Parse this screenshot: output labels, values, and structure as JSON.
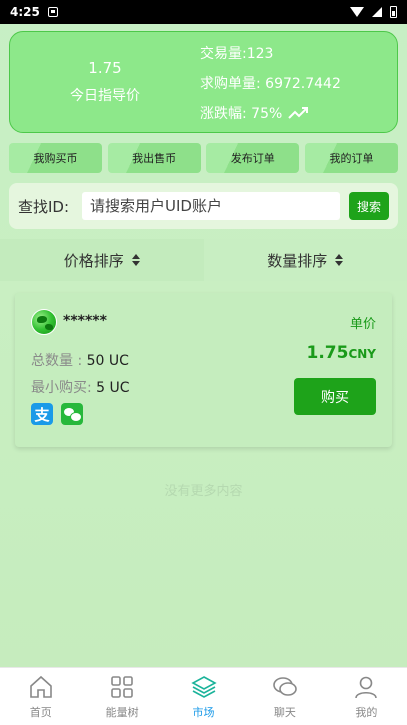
{
  "status_bar": {
    "time": "4:25"
  },
  "summary": {
    "price": "1.75",
    "price_label": "今日指导价",
    "volume": "交易量:123",
    "buy_order_qty": "求购单量: 6972.7442",
    "change": "涨跌幅: 75%"
  },
  "actions": [
    {
      "label": "我购买币"
    },
    {
      "label": "我出售币"
    },
    {
      "label": "发布订单"
    },
    {
      "label": "我的订单"
    }
  ],
  "search": {
    "label": "查找ID:",
    "placeholder": "请搜索用户UID账户",
    "button": "搜索"
  },
  "sort": {
    "price": "价格排序",
    "quantity": "数量排序"
  },
  "order": {
    "user": "******",
    "total_label": "总数量 : ",
    "total_value": "50 UC",
    "min_label": "最小购买: ",
    "min_value": "5 UC",
    "unit_label": "单价",
    "unit_price": "1.75",
    "currency": "CNY",
    "buy_button": "购买",
    "payments": [
      "alipay-icon",
      "wechat-icon"
    ]
  },
  "no_more_text": "没有更多内容",
  "nav": [
    {
      "label": "首页",
      "icon": "home-icon"
    },
    {
      "label": "能量树",
      "icon": "grid-icon"
    },
    {
      "label": "市场",
      "icon": "layers-icon",
      "active": true
    },
    {
      "label": "聊天",
      "icon": "chat-icon"
    },
    {
      "label": "我的",
      "icon": "user-icon"
    }
  ],
  "colors": {
    "accent_green": "#1ea31a",
    "active_blue": "#1a9ae8",
    "card_green": "#8de88a"
  }
}
